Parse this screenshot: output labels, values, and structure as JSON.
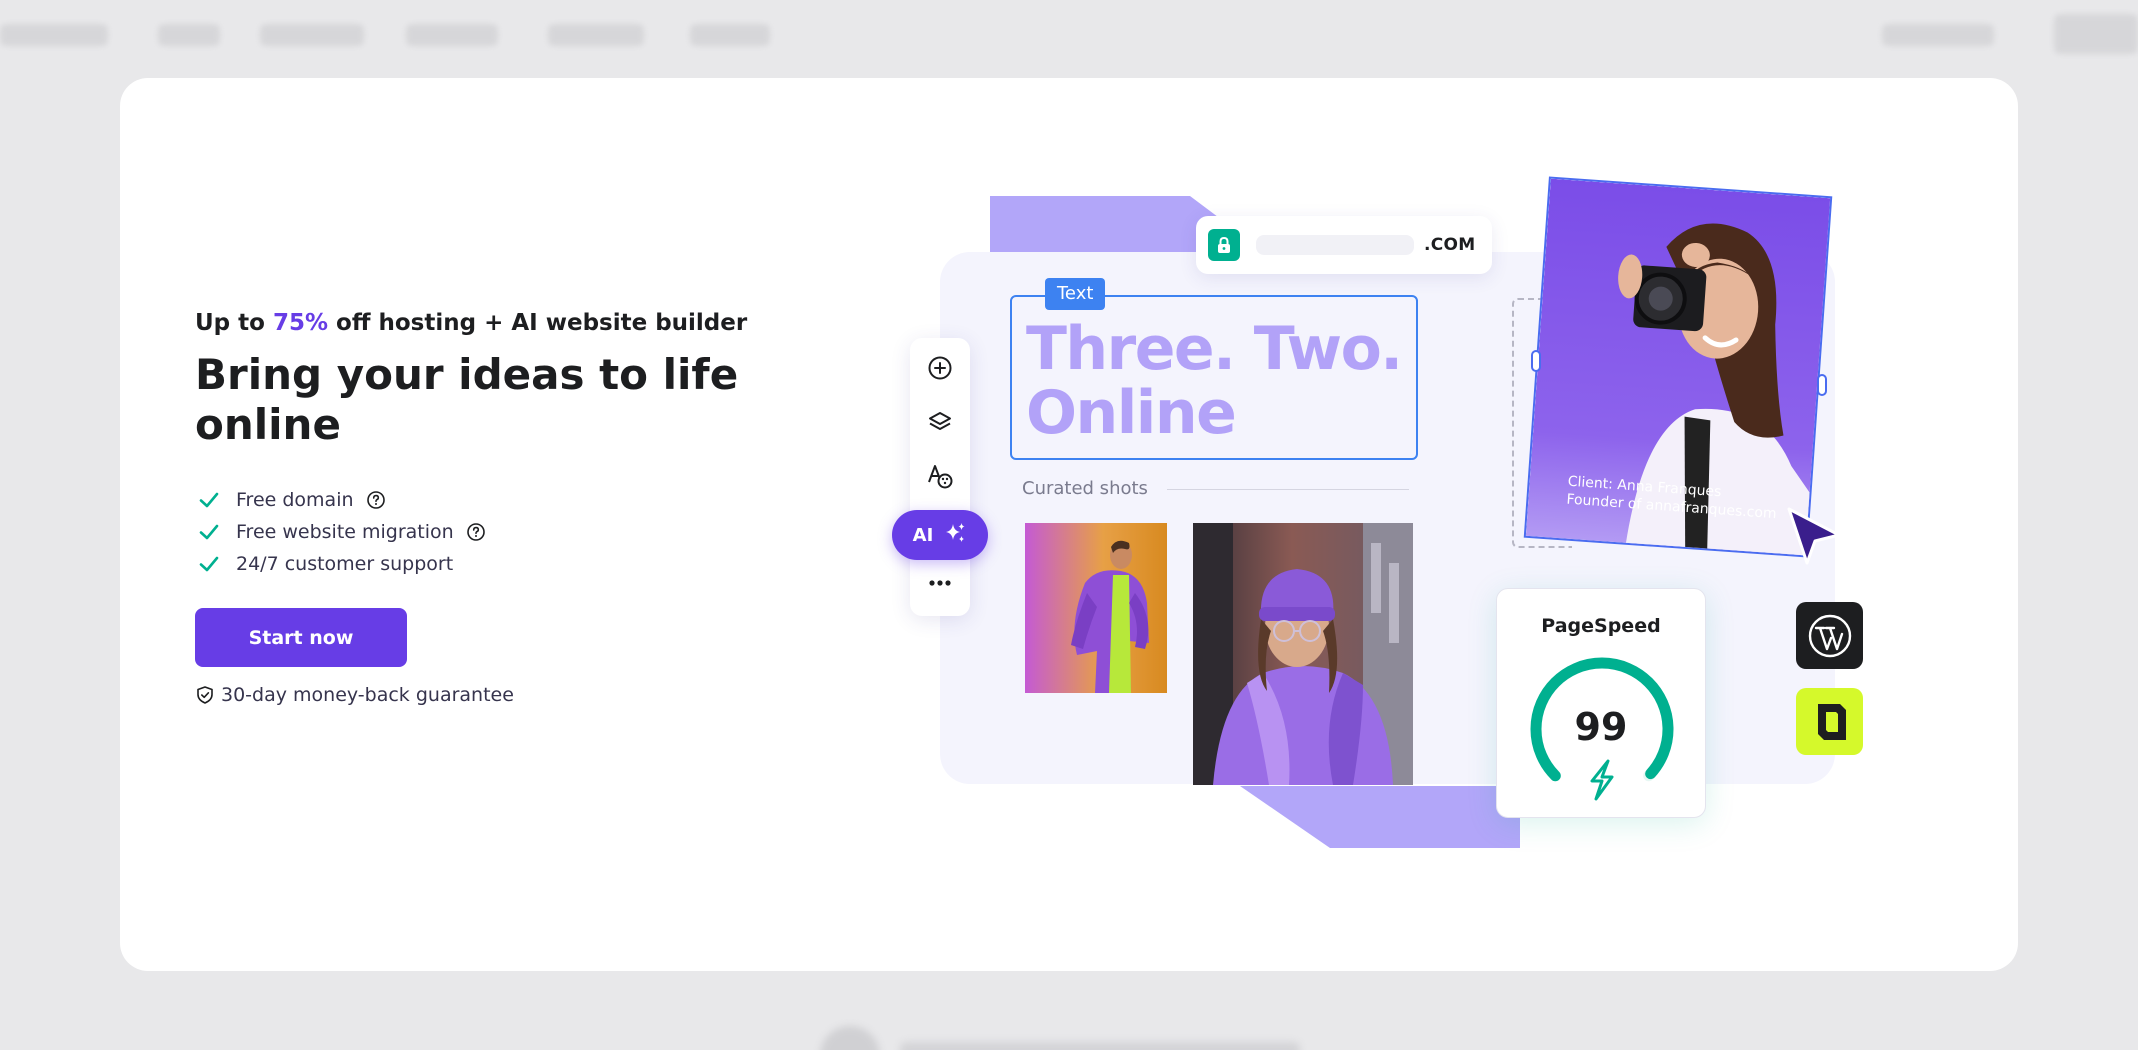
{
  "offer": {
    "prefix": "Up to",
    "discount": "75%",
    "suffix": "off hosting + AI website builder"
  },
  "headline": "Bring your ideas to life online",
  "features": [
    {
      "label": "Free domain",
      "has_help": true
    },
    {
      "label": "Free website migration",
      "has_help": true
    },
    {
      "label": "24/7 customer support",
      "has_help": false
    }
  ],
  "cta_label": "Start now",
  "guarantee": "30-day money-back guarantee",
  "illustration": {
    "url_tld": ".COM",
    "text_tag": "Text",
    "text_line1": "Three. Two.",
    "text_line2": "Online",
    "curated_label": "Curated shots",
    "ai_label": "AI",
    "client_name": "Client: Anna Franques",
    "client_role": "Founder of annafranques.com",
    "pagespeed_title": "PageSpeed",
    "pagespeed_score": "99",
    "pagespeed_progress": 0.99
  },
  "icons": [
    "check-icon",
    "help-icon",
    "shield-icon",
    "lock-icon",
    "add-icon",
    "layers-icon",
    "typography-icon",
    "sparkle-icon",
    "more-icon",
    "cursor-icon",
    "bolt-icon",
    "wordpress-icon",
    "builder-logo-icon"
  ],
  "colors": {
    "brand": "#673de6",
    "check": "#00b090",
    "text_box_border": "#3d82f1",
    "big_text": "#b2a2f8",
    "gauge": "#00b090",
    "lime": "#d5f92b"
  }
}
